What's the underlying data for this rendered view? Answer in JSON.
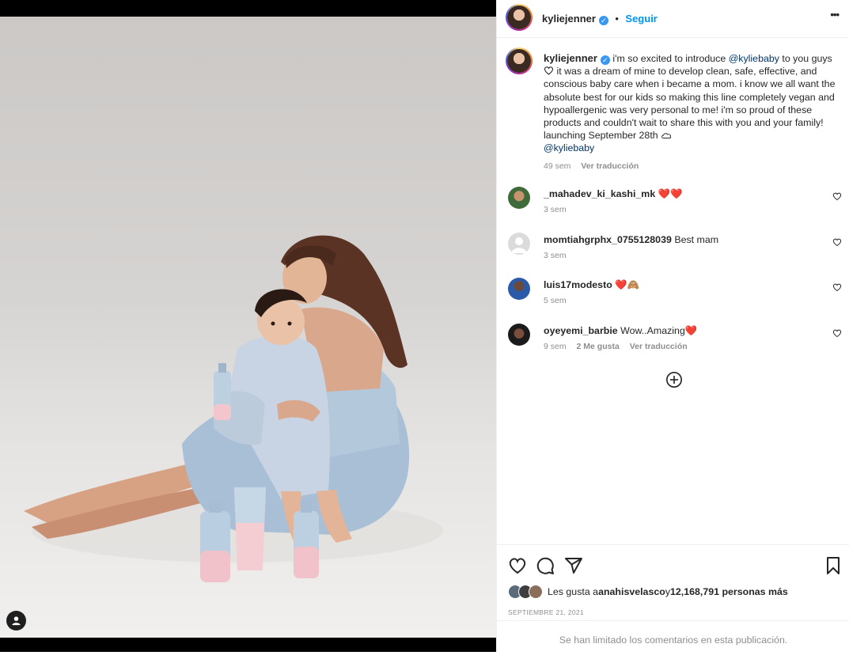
{
  "post": {
    "username": "kyliejenner",
    "follow_label": "Seguir",
    "more_label": "•••",
    "caption_user": "kyliejenner",
    "caption_parts": {
      "a": "i'm so excited to introduce ",
      "mention1": "@kyliebaby",
      "b": " to you guys ",
      "c": " it was a dream of mine to develop clean, safe, effective, and conscious baby care when i became a mom. i know we all want the absolute best for our kids so making this line completely vegan and hypoallergenic was very personal to me! i'm so proud of these products and couldn't wait to share this with you and your family! launching September 28th ",
      "mention2": "@kyliebaby"
    },
    "caption_time": "49 sem",
    "translate_label": "Ver traducción"
  },
  "comments": [
    {
      "user": "_mahadev_ki_kashi_mk",
      "text": "",
      "emoji": "❤️❤️",
      "time": "3 sem",
      "likes": "",
      "translate": ""
    },
    {
      "user": "momtiahgrphx_0755128039",
      "text": "Best mam",
      "emoji": "",
      "time": "3 sem",
      "likes": "",
      "translate": ""
    },
    {
      "user": "luis17modesto",
      "text": "",
      "emoji": "❤️🙈",
      "time": "5 sem",
      "likes": "",
      "translate": ""
    },
    {
      "user": "oyeyemi_barbie",
      "text": "Wow..Amazing",
      "emoji": "❤️",
      "time": "9 sem",
      "likes": "2 Me gusta",
      "translate": "Ver traducción"
    }
  ],
  "likes": {
    "prefix": "Les gusta a ",
    "user": "anahisvelasco",
    "middle": " y ",
    "count": "12,168,791 personas más"
  },
  "date": "SEPTIEMBRE 21, 2021",
  "limited_comments": "Se han limitado los comentarios en esta publicación.",
  "colors": {
    "accent": "#0095f6",
    "verified": "#3897f0",
    "heart": "#ed4956"
  },
  "icons": [
    "heart-icon",
    "comment-icon",
    "share-icon",
    "bookmark-icon",
    "plus-circle-icon",
    "tag-user-icon",
    "more-icon",
    "verified-badge-icon"
  ]
}
